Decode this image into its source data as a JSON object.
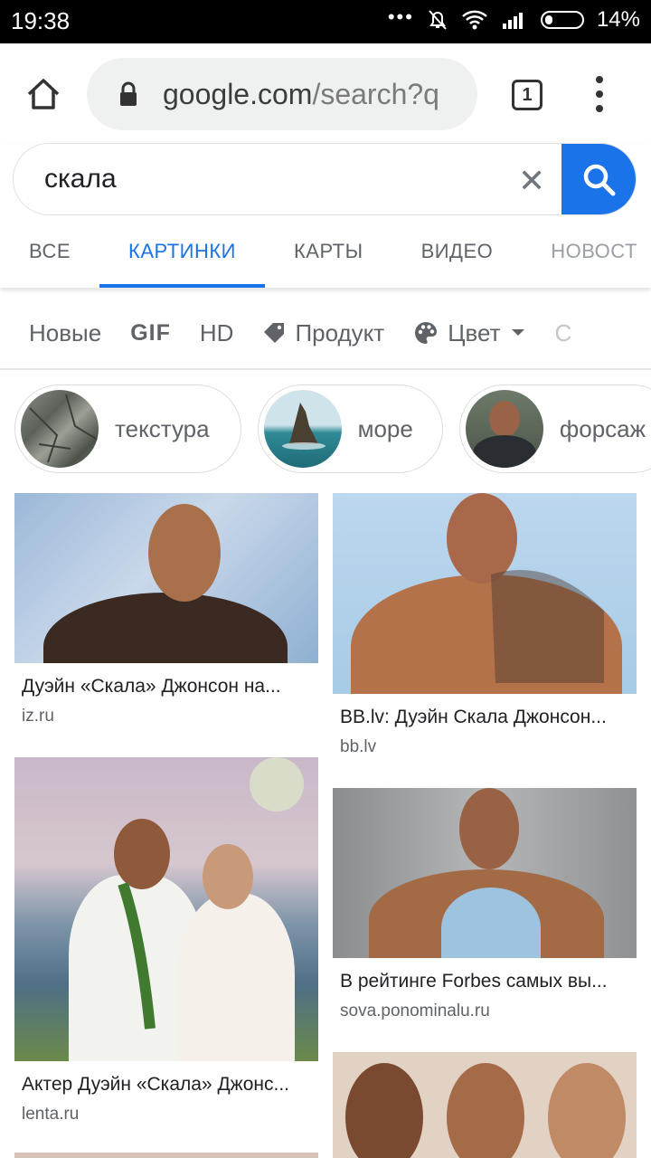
{
  "status_bar": {
    "time": "19:38",
    "dots": "•••",
    "battery": "14%"
  },
  "browser": {
    "url_host": "google.com",
    "url_path": "/search?q",
    "tab_count": "1"
  },
  "search": {
    "query": "скала",
    "clear_glyph": "✕"
  },
  "nav_tabs": [
    {
      "label": "ВСЕ"
    },
    {
      "label": "КАРТИНКИ"
    },
    {
      "label": "КАРТЫ"
    },
    {
      "label": "ВИДЕО"
    },
    {
      "label": "НОВОСТ"
    }
  ],
  "filters": [
    {
      "label": "Новые"
    },
    {
      "label": "GIF"
    },
    {
      "label": "HD"
    },
    {
      "label": "Продукт",
      "icon": "tag-icon"
    },
    {
      "label": "Цвет",
      "icon": "palette-icon"
    },
    {
      "label": "С"
    }
  ],
  "related": [
    {
      "label": "текстура"
    },
    {
      "label": "море"
    },
    {
      "label": "форсаж"
    }
  ],
  "results": [
    {
      "title": "Дуэйн «Скала» Джонсон на...",
      "source": "iz.ru"
    },
    {
      "title": "BB.lv: Дуэйн Скала Джонсон...",
      "source": "bb.lv"
    },
    {
      "title": "Актер Дуэйн «Скала» Джонс...",
      "source": "lenta.ru"
    },
    {
      "title": "В рейтинге Forbes самых вы...",
      "source": "sova.ponominalu.ru"
    }
  ],
  "colors": {
    "accent": "#1a73e8",
    "text": "#202124",
    "muted": "#5f6368"
  }
}
